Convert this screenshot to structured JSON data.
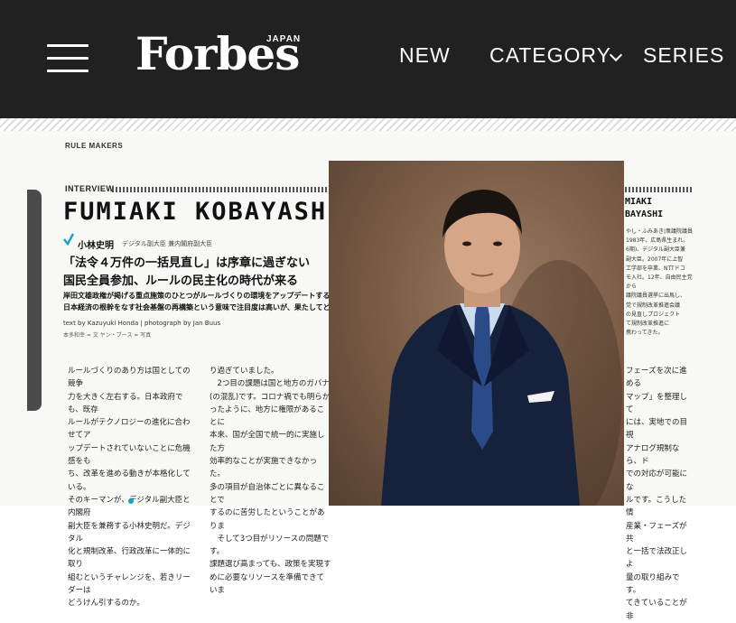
{
  "header": {
    "logo_text": "Forbes",
    "logo_sub": "JAPAN",
    "nav": {
      "new": "NEW",
      "category": "CATEGORY",
      "series": "SERIES"
    },
    "icons": {
      "menu": "hamburger-icon",
      "category_dropdown": "chevron-down-icon"
    }
  },
  "article": {
    "section_label": "RULE MAKERS",
    "interview_label": "INTERVIEW",
    "name_en": "FUMIAKI KOBAYASHI",
    "name_jp": "小林史明",
    "role_jp": "デジタル副大臣 兼内閣府副大臣",
    "headline_line1": "「法令４万件の一括見直し」は序章に過ぎない",
    "headline_line2": "国民全員参加、ルールの民主化の時代が来る",
    "lead_line1": "岸田文雄政権が掲げる重点施策のひとつがルールづくりの環境をアップデートすることだ",
    "lead_line2": "日本経済の根幹をなす社会基盤の再構築という意味で注目度は高いが、果たしてどこまで",
    "credit": "text by Kazuyuki Honda | photograph by Jan Buus",
    "credit_jp": "本多和幸 = 文  ヤン・ブース = 写真",
    "col1": [
      "ルールづくりのあり方は国としての競争",
      "力を大きく左右する。日本政府でも、既存",
      "ルールがテクノロジーの進化に合わせてア",
      "ップデートされていないことに危機感をも",
      "ち、改革を進める動きが本格化している。",
      "そのキーマンが、デジタル副大臣と内閣府",
      "副大臣を兼務する小林史明だ。デジタル",
      "化と規制改革、行政改革に一体的に取り",
      "組むというチャレンジを、若きリーダーは",
      "どうけん引するのか。"
    ],
    "col2": [
      "り過ぎていました。",
      "　2つ目の課題は国と地方のガバナ",
      "(の混乱)です。コロナ禍でも明らか",
      "ったように、地方に権限があることに",
      "本来、国が全国で統一的に実施した方",
      "効率的なことが実施できなかった。",
      "多の項目が自治体ごとに異なることで",
      "するのに苦労したということがありま",
      "　そして3つ目がリソースの問題です。",
      "課題選び高まっても、政策を実現す",
      "めに必要なリソースを準備できていま"
    ],
    "right_name1": "MIAKI",
    "right_name2": "BAYASHI",
    "right_bio": [
      "やし・ふみあき|衆議院議員",
      "1983年、広島県生まれ。",
      "6期)、デジタル副大臣兼",
      "副大臣。2007年に上智",
      "工学部を卒業、NTTドコ",
      "モ入社。12年、自由民主党から",
      "議院議員選挙に出馬し、",
      "党で規制改革推進会議",
      "の見直しプロジェクト",
      "て規制改革推進に",
      "携わってきた。"
    ],
    "right_text": [
      "フェーズを次に進める",
      "マップ」を整理して",
      "には、実地での目視",
      "アナログ規制なら、ド",
      "での対応が可能にな",
      "ルです。こうした情",
      "産業・フェーズが共",
      "と一括で法改正しよ",
      "量の取り組みです。",
      "てきていることが非"
    ]
  },
  "photo": {
    "subject": "portrait-photo"
  }
}
